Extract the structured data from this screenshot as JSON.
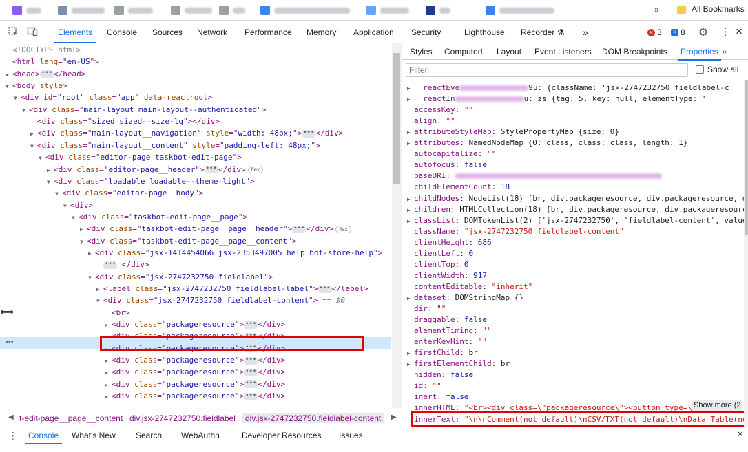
{
  "bookmarks": {
    "items": [
      {
        "color": "#8b5cf6",
        "label": "MR"
      },
      {
        "color": "#7c8fb0",
        "label": "ocuwer"
      },
      {
        "color": "#9aa0a6",
        "label": "B0dH"
      },
      {
        "color": "#9aa0a6",
        "label": "Ewcer"
      },
      {
        "color": "#9aa0a6",
        "label": "eB"
      },
      {
        "color": "#3b82f6",
        "label": "ocworder"
      },
      {
        "color": "#60a5fa",
        "label": "Rgrfto"
      },
      {
        "color": "#1e3a8a",
        "label": "nd"
      },
      {
        "color": "#3b82f6",
        "label": "disgcrt"
      }
    ],
    "more_label": "»",
    "all_bookmarks": "All Bookmarks"
  },
  "topbar": {
    "tabs": [
      "Elements",
      "Console",
      "Sources",
      "Network",
      "Performance",
      "Memory",
      "Application",
      "Security",
      "Lighthouse",
      "Recorder"
    ],
    "active": "Elements",
    "more": "»",
    "errors": "3",
    "messages": "8"
  },
  "dom_tree": {
    "doctype": "<!DOCTYPE html>",
    "html_lang": "en-US",
    "body_style": "",
    "root_id": "root",
    "root_class": "app",
    "root_extra_attr": "data-reactroot",
    "main_layout_class": "main-layout main-layout--authenticated",
    "sized_class": "sized sized--size-lg",
    "nav_class": "main-layout__navigation",
    "nav_style": "width: 48px;",
    "content_class": "main-layout__content",
    "content_style": "padding-left: 48px;",
    "editor_class": "editor-page taskbot-edit-page",
    "editor_header_class": "editor-page__header",
    "loadable_class": "loadable loadable--theme-light",
    "editor_body_class": "editor-page__body",
    "taskbot_page_class": "taskbot-edit-page__page",
    "taskbot_header_class": "taskbot-edit-page__page__header",
    "taskbot_content_class": "taskbot-edit-page__page__content",
    "help_class": "jsx-1414454066 jsx-2353497005 help bot-store-help",
    "fieldlabel_class": "jsx-2747232750 fieldlabel",
    "label_class": "jsx-2747232750 fieldlabel-label",
    "selected_class": "jsx-2747232750 fieldlabel-content",
    "selected_suffix": "== $0",
    "br": "<br>",
    "package_class": "packageresource",
    "flex_badge": "flex"
  },
  "breadcrumb": [
    "t-edit-page__page__content",
    "div.jsx-2747232750.fieldlabel",
    "div.jsx-2747232750.fieldlabel-content"
  ],
  "subtabs": {
    "items": [
      "Styles",
      "Computed",
      "Layout",
      "Event Listeners",
      "DOM Breakpoints",
      "Properties"
    ],
    "active": "Properties",
    "more": "»"
  },
  "filter": {
    "placeholder": "Filter",
    "show_all": "Show all"
  },
  "properties": [
    {
      "expand": true,
      "key": "__reactEve",
      "blur": true,
      "rest": "9u: {className: 'jsx-2747232750 fieldlabel-c"
    },
    {
      "expand": true,
      "key": "__reactIn",
      "blur": true,
      "rest": "u: zs {tag: 5, key: null, elementType: '"
    },
    {
      "expand": false,
      "key": "accessKey",
      "val": "\"\"",
      "kind": "ps"
    },
    {
      "expand": false,
      "key": "align",
      "val": "\"\"",
      "kind": "ps"
    },
    {
      "expand": true,
      "key": "attributeStyleMap",
      "val": "StylePropertyMap {size: 0}",
      "kind": "pd"
    },
    {
      "expand": true,
      "key": "attributes",
      "val": "NamedNodeMap {0: class, class: class, length: 1}",
      "kind": "pd"
    },
    {
      "expand": false,
      "key": "autocapitalize",
      "val": "\"\"",
      "kind": "ps"
    },
    {
      "expand": false,
      "key": "autofocus",
      "val": "false",
      "kind": "pb"
    },
    {
      "expand": false,
      "key": "baseURI",
      "val": "",
      "kind": "blur"
    },
    {
      "expand": false,
      "key": "childElementCount",
      "val": "18",
      "kind": "pn"
    },
    {
      "expand": true,
      "key": "childNodes",
      "val": "NodeList(18) [br, div.packageresource, div.packageresource, d",
      "kind": "pd"
    },
    {
      "expand": true,
      "key": "children",
      "val": "HTMLCollection(18) [br, div.packageresource, div.packageresourc",
      "kind": "pd"
    },
    {
      "expand": true,
      "key": "classList",
      "val": "DOMTokenList(2) ['jsx-2747232750', 'fieldlabel-content', value",
      "kind": "pd"
    },
    {
      "expand": false,
      "key": "className",
      "val": "\"jsx-2747232750 fieldlabel-content\"",
      "kind": "ps"
    },
    {
      "expand": false,
      "key": "clientHeight",
      "val": "686",
      "kind": "pn"
    },
    {
      "expand": false,
      "key": "clientLeft",
      "val": "0",
      "kind": "pn"
    },
    {
      "expand": false,
      "key": "clientTop",
      "val": "0",
      "kind": "pn"
    },
    {
      "expand": false,
      "key": "clientWidth",
      "val": "917",
      "kind": "pn"
    },
    {
      "expand": false,
      "key": "contentEditable",
      "val": "\"inherit\"",
      "kind": "ps"
    },
    {
      "expand": true,
      "key": "dataset",
      "val": "DOMStringMap {}",
      "kind": "pd"
    },
    {
      "expand": false,
      "key": "dir",
      "val": "\"\"",
      "kind": "ps"
    },
    {
      "expand": false,
      "key": "draggable",
      "val": "false",
      "kind": "pb"
    },
    {
      "expand": false,
      "key": "elementTiming",
      "val": "\"\"",
      "kind": "ps"
    },
    {
      "expand": false,
      "key": "enterKeyHint",
      "val": "\"\"",
      "kind": "ps"
    },
    {
      "expand": true,
      "key": "firstChild",
      "val": "br",
      "kind": "pd"
    },
    {
      "expand": true,
      "key": "firstElementChild",
      "val": "br",
      "kind": "pd"
    },
    {
      "expand": false,
      "key": "hidden",
      "val": "false",
      "kind": "pb"
    },
    {
      "expand": false,
      "key": "id",
      "val": "\"\"",
      "kind": "ps"
    },
    {
      "expand": false,
      "key": "inert",
      "val": "false",
      "kind": "pb"
    },
    {
      "expand": false,
      "key": "innerHTML",
      "val": "\"<br><div class=\\\"packageresource\\\"><button type=\\",
      "kind": "ps"
    },
    {
      "expand": false,
      "key": "innerText",
      "val": "\"\\n\\nComment(not default)\\nCSV/TXT(not default)\\nData Table(no",
      "kind": "ps"
    }
  ],
  "show_more": "Show more (2",
  "drawer": {
    "tabs": [
      "Console",
      "What's New",
      "Search",
      "WebAuthn",
      "Developer Resources",
      "Issues"
    ],
    "active": "Console"
  },
  "colors": {
    "accent": "#1a73e8",
    "highlight": "#e00000",
    "selection": "#cfe8fc"
  }
}
